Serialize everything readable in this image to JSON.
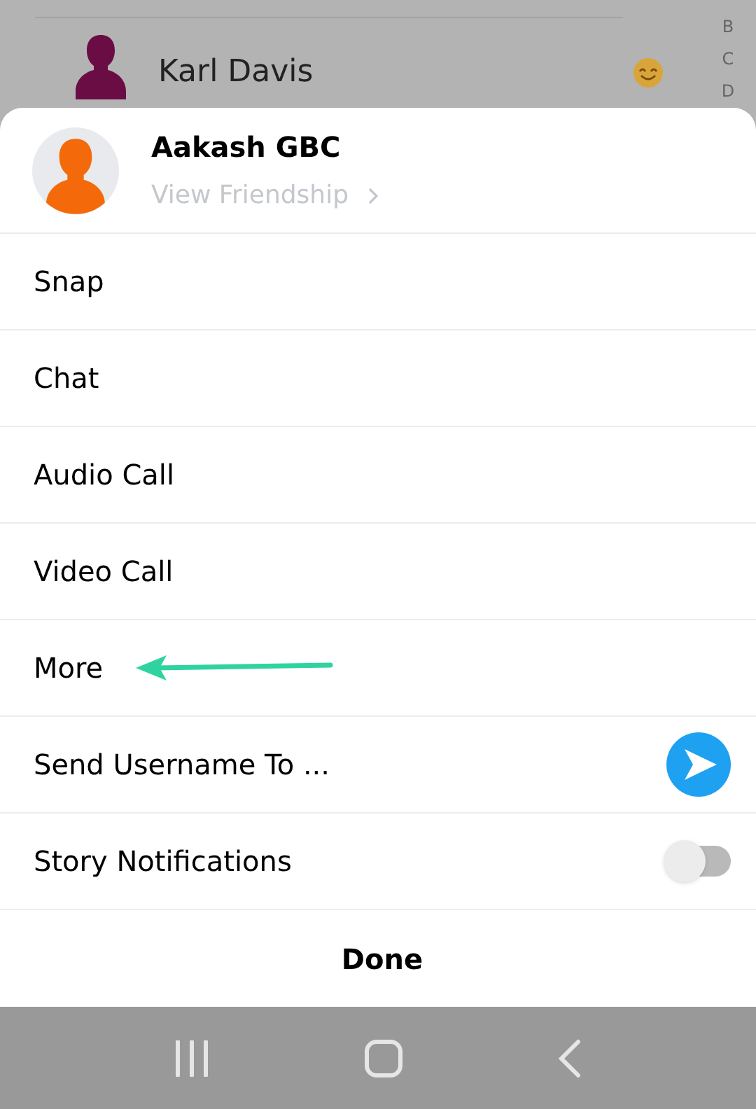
{
  "background": {
    "contact": {
      "name": "Karl Davis"
    },
    "index_letters": [
      "B",
      "C",
      "D"
    ]
  },
  "sheet": {
    "profile": {
      "name": "Aakash GBC",
      "link": "View Friendship"
    },
    "rows": [
      {
        "kind": "plain",
        "label": "Snap",
        "annotated": false
      },
      {
        "kind": "plain",
        "label": "Chat",
        "annotated": false
      },
      {
        "kind": "plain",
        "label": "Audio Call",
        "annotated": false
      },
      {
        "kind": "plain",
        "label": "Video Call",
        "annotated": false
      },
      {
        "kind": "plain",
        "label": "More",
        "annotated": true
      },
      {
        "kind": "send",
        "label": "Send Username To ...",
        "annotated": false
      },
      {
        "kind": "toggle",
        "label": "Story Notifications",
        "on": false,
        "annotated": false
      },
      {
        "kind": "done",
        "label": "Done",
        "annotated": false
      }
    ]
  }
}
